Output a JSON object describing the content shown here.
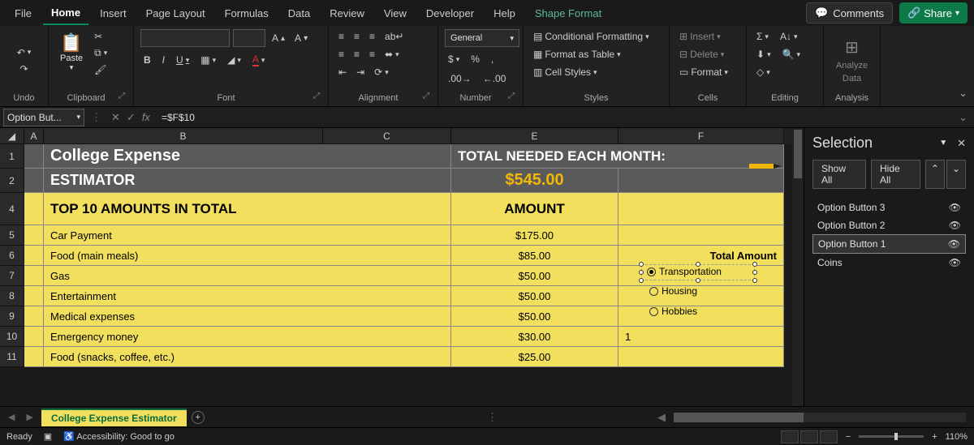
{
  "tabs": {
    "file": "File",
    "home": "Home",
    "insert": "Insert",
    "pagelayout": "Page Layout",
    "formulas": "Formulas",
    "data": "Data",
    "review": "Review",
    "view": "View",
    "developer": "Developer",
    "help": "Help",
    "shapeformat": "Shape Format"
  },
  "topbuttons": {
    "comments": "Comments",
    "share": "Share"
  },
  "ribbon": {
    "undo": "Undo",
    "clipboard": "Clipboard",
    "paste": "Paste",
    "font": "Font",
    "alignment": "Alignment",
    "number": "Number",
    "styles": "Styles",
    "cells": "Cells",
    "editing": "Editing",
    "analysis": "Analysis",
    "numberFormat": "General",
    "condFmt": "Conditional Formatting",
    "fmtTable": "Format as Table",
    "cellStyles": "Cell Styles",
    "insert": "Insert",
    "delete": "Delete",
    "format": "Format",
    "analyze": "Analyze",
    "analyzeData": "Data",
    "bold": "B",
    "italic": "I",
    "underline": "U"
  },
  "nameBox": "Option But...",
  "formula": "=$F$10",
  "columns": {
    "A": "A",
    "B": "B",
    "C": "C",
    "E": "E",
    "F": "F"
  },
  "rows": {
    "1": "1",
    "2": "2",
    "4": "4",
    "5": "5",
    "6": "6",
    "7": "7",
    "8": "8",
    "9": "9",
    "10": "10",
    "11": "11"
  },
  "sheet": {
    "title1": "College Expense",
    "title2": "ESTIMATOR",
    "totalLabel": "TOTAL NEEDED EACH MONTH:",
    "totalValue": "$545.00",
    "topHeader": "TOP 10 AMOUNTS IN TOTAL",
    "amountHeader": "AMOUNT",
    "items": [
      {
        "label": "Car Payment",
        "amount": "$175.00"
      },
      {
        "label": "Food (main meals)",
        "amount": "$85.00"
      },
      {
        "label": "Gas",
        "amount": "$50.00"
      },
      {
        "label": "Entertainment",
        "amount": "$50.00"
      },
      {
        "label": "Medical expenses",
        "amount": "$50.00"
      },
      {
        "label": "Emergency money",
        "amount": "$30.00"
      },
      {
        "label": "Food (snacks, coffee, etc.)",
        "amount": "$25.00"
      }
    ],
    "optionGroup": {
      "title": "Total Amount",
      "opt1": "Transportation",
      "opt2": "Housing",
      "opt3": "Hobbies"
    },
    "f10": "1"
  },
  "selectionPane": {
    "title": "Selection",
    "showAll": "Show All",
    "hideAll": "Hide All",
    "items": [
      "Option Button 3",
      "Option Button 2",
      "Option Button 1",
      "Coins"
    ],
    "selectedIndex": 2
  },
  "sheetTab": "College Expense Estimator",
  "status": {
    "ready": "Ready",
    "accessibility": "Accessibility: Good to go",
    "zoom": "110%"
  }
}
